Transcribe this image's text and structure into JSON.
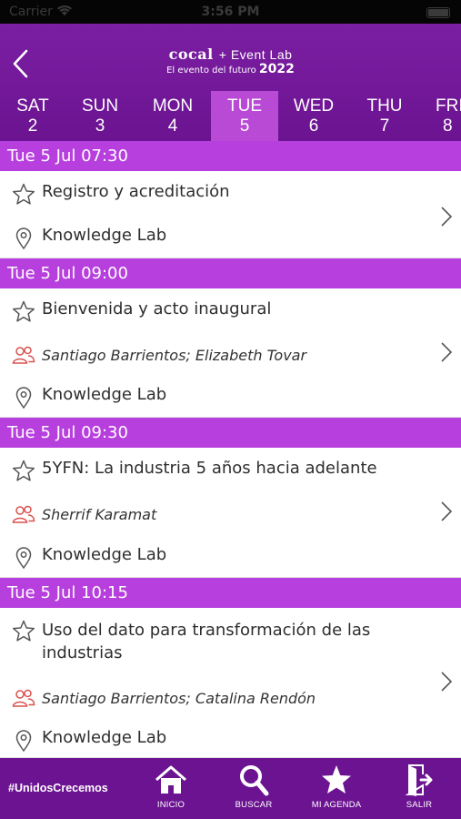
{
  "status_bar": {
    "carrier": "Carrier",
    "time": "3:56 PM"
  },
  "header": {
    "logo_brand": "cocal",
    "logo_suffix": "+ Event Lab",
    "logo_tagline": "El evento del futuro",
    "logo_year": "2022"
  },
  "days": [
    {
      "dow": "SAT",
      "num": "2"
    },
    {
      "dow": "SUN",
      "num": "3"
    },
    {
      "dow": "MON",
      "num": "4"
    },
    {
      "dow": "TUE",
      "num": "5"
    },
    {
      "dow": "WED",
      "num": "6"
    },
    {
      "dow": "THU",
      "num": "7"
    },
    {
      "dow": "FRI",
      "num": "8"
    }
  ],
  "selected_day_index": 3,
  "sessions": [
    {
      "time_header": "Tue 5 Jul 07:30",
      "title": "Registro y acreditación",
      "speakers": "",
      "location": "Knowledge Lab"
    },
    {
      "time_header": "Tue 5 Jul 09:00",
      "title": "Bienvenida y acto inaugural",
      "speakers": "Santiago Barrientos; Elizabeth Tovar",
      "location": "Knowledge Lab"
    },
    {
      "time_header": "Tue 5 Jul 09:30",
      "title": "5YFN: La industria 5 años hacia adelante",
      "speakers": "Sherrif Karamat",
      "location": "Knowledge Lab"
    },
    {
      "time_header": "Tue 5 Jul 10:15",
      "title": "Uso del dato para transformación de las industrias",
      "speakers": "Santiago Barrientos; Catalina Rendón",
      "location": "Knowledge Lab"
    }
  ],
  "tabbar": {
    "hashtag": "#UnidosCrecemos",
    "tabs": [
      {
        "label": "INICIO",
        "icon": "home-icon"
      },
      {
        "label": "BUSCAR",
        "icon": "search-icon"
      },
      {
        "label": "MI AGENDA",
        "icon": "star-icon"
      },
      {
        "label": "SALIR",
        "icon": "exit-icon"
      }
    ]
  },
  "colors": {
    "header_purple": "#7b1fa2",
    "section_header": "#b73fdd",
    "selected_day": "#b94ad6",
    "speaker_icon": "#d9534f"
  }
}
